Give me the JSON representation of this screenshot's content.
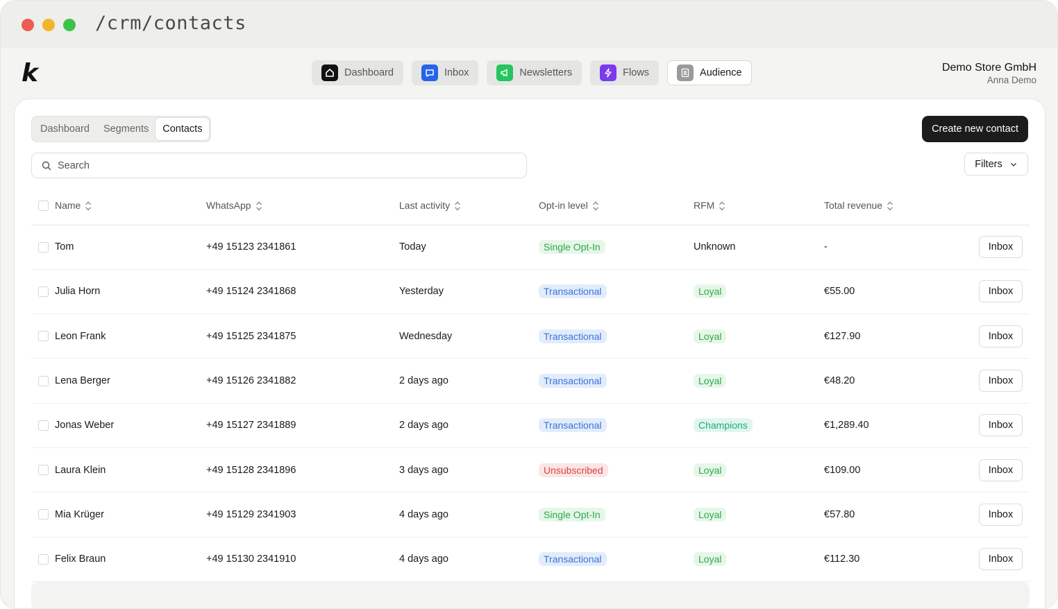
{
  "browser": {
    "url": "/crm/contacts"
  },
  "app": {
    "logo": "k"
  },
  "topnav": [
    {
      "label": "Dashboard",
      "icon": "home-icon",
      "color": "#111111"
    },
    {
      "label": "Inbox",
      "icon": "chat-icon",
      "color": "#2563eb"
    },
    {
      "label": "Newsletters",
      "icon": "megaphone-icon",
      "color": "#22c55e"
    },
    {
      "label": "Flows",
      "icon": "bolt-icon",
      "color": "#7c3aed"
    },
    {
      "label": "Audience",
      "icon": "contacts-book-icon",
      "color": "#9a9a9a"
    }
  ],
  "account": {
    "store": "Demo Store GmbH",
    "user": "Anna Demo"
  },
  "subtabs": [
    "Dashboard",
    "Segments",
    "Contacts"
  ],
  "actions": {
    "create": "Create new contact",
    "filters": "Filters",
    "row_action": "Inbox"
  },
  "search": {
    "placeholder": "Search"
  },
  "table": {
    "columns": [
      "Name",
      "WhatsApp",
      "Last activity",
      "Opt-in level",
      "RFM",
      "Total revenue"
    ],
    "rows": [
      {
        "name": "Tom",
        "whatsapp": "+49 15123 2341861",
        "last": "Today",
        "optin": "Single Opt-In",
        "rfm": "Unknown",
        "revenue": "-"
      },
      {
        "name": "Julia Horn",
        "whatsapp": "+49 15124 2341868",
        "last": "Yesterday",
        "optin": "Transactional",
        "rfm": "Loyal",
        "revenue": "€55.00"
      },
      {
        "name": "Leon Frank",
        "whatsapp": "+49 15125 2341875",
        "last": "Wednesday",
        "optin": "Transactional",
        "rfm": "Loyal",
        "revenue": "€127.90"
      },
      {
        "name": "Lena Berger",
        "whatsapp": "+49 15126 2341882",
        "last": "2 days ago",
        "optin": "Transactional",
        "rfm": "Loyal",
        "revenue": "€48.20"
      },
      {
        "name": "Jonas Weber",
        "whatsapp": "+49 15127 2341889",
        "last": "2 days ago",
        "optin": "Transactional",
        "rfm": "Champions",
        "revenue": "€1,289.40"
      },
      {
        "name": "Laura Klein",
        "whatsapp": "+49 15128 2341896",
        "last": "3 days ago",
        "optin": "Unsubscribed",
        "rfm": "Loyal",
        "revenue": "€109.00"
      },
      {
        "name": "Mia Krüger",
        "whatsapp": "+49 15129 2341903",
        "last": "4 days ago",
        "optin": "Single Opt-In",
        "rfm": "Loyal",
        "revenue": "€57.80"
      },
      {
        "name": "Felix Braun",
        "whatsapp": "+49 15130 2341910",
        "last": "4 days ago",
        "optin": "Transactional",
        "rfm": "Loyal",
        "revenue": "€112.30"
      }
    ]
  },
  "badge_colors": {
    "Single Opt-In": "green",
    "Transactional": "blue",
    "Unsubscribed": "red",
    "Loyal": "green",
    "Champions": "teal"
  }
}
